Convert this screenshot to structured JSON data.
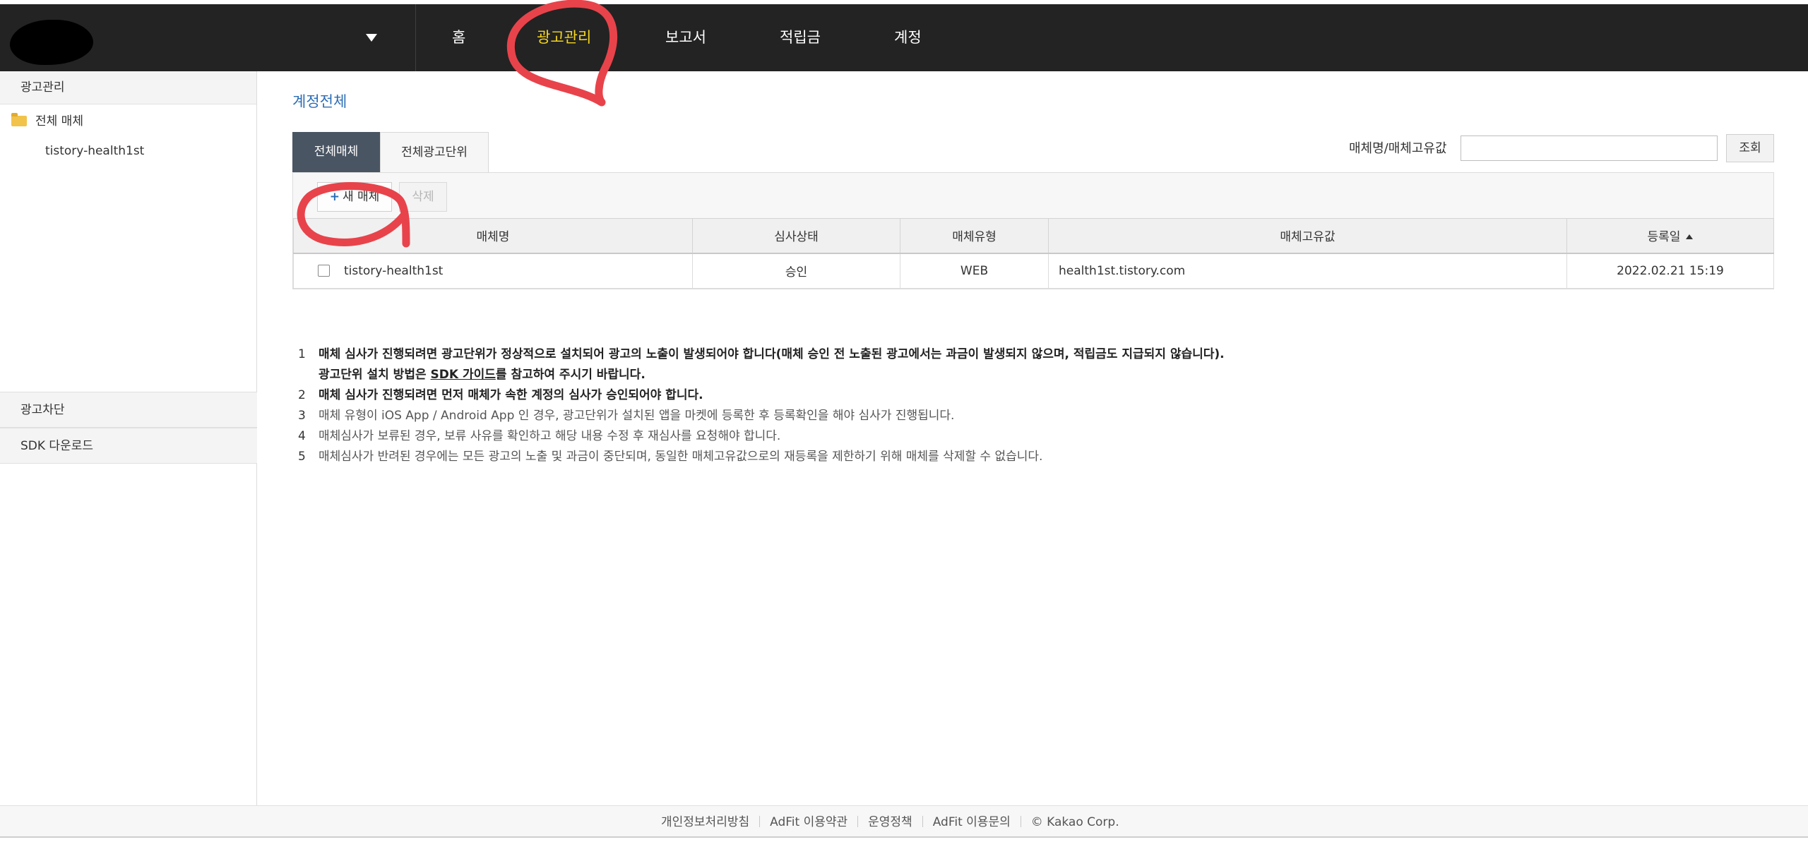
{
  "header": {
    "nav": [
      {
        "label": "홈",
        "active": false
      },
      {
        "label": "광고관리",
        "active": true
      },
      {
        "label": "보고서",
        "active": false
      },
      {
        "label": "적립금",
        "active": false
      },
      {
        "label": "계정",
        "active": false
      }
    ],
    "accent_color": "#f5d61f"
  },
  "sidebar": {
    "header": "광고관리",
    "tree_root": "전체 매체",
    "tree_child": "tistory-health1st",
    "sections": [
      "광고차단",
      "SDK 다운로드"
    ]
  },
  "main": {
    "title": "계정전체",
    "tabs": [
      {
        "label": "전체매체",
        "active": true
      },
      {
        "label": "전체광고단위",
        "active": false
      }
    ],
    "search": {
      "label": "매체명/매체고유값",
      "value": "",
      "button": "조회"
    },
    "toolbar": {
      "new_label": "새 매체",
      "delete_label": "삭제"
    },
    "table": {
      "columns": [
        "매체명",
        "심사상태",
        "매체유형",
        "매체고유값",
        "등록일"
      ],
      "rows": [
        {
          "name": "tistory-health1st",
          "status": "승인",
          "type": "WEB",
          "key": "health1st.tistory.com",
          "date": "2022.02.21 15:19"
        }
      ]
    },
    "notes": [
      {
        "num": "1",
        "text": "매체 심사가 진행되려면 광고단위가 정상적으로 설치되어 광고의 노출이 발생되어야 합니다(매체 승인 전 노출된 광고에서는 과금이 발생되지 않으며, 적립금도 지급되지 않습니다)."
      },
      {
        "pre": "광고단위 설치 방법은 ",
        "link": "SDK 가이드",
        "post": "를 참고하여 주시기 바랍니다."
      },
      {
        "num": "2",
        "text": "매체 심사가 진행되려면 먼저 매체가 속한 계정의 심사가 승인되어야 합니다."
      },
      {
        "num": "3",
        "text": "매체 유형이 iOS App / Android App 인 경우, 광고단위가 설치된 앱을 마켓에 등록한 후 등록확인을 해야 심사가 진행됩니다."
      },
      {
        "num": "4",
        "text": "매체심사가 보류된 경우, 보류 사유를 확인하고 해당 내용 수정 후 재심사를 요청해야 합니다."
      },
      {
        "num": "5",
        "text": "매체심사가 반려된 경우에는 모든 광고의 노출 및 과금이 중단되며, 동일한 매체고유값으로의 재등록을 제한하기 위해 매체를 삭제할 수 없습니다."
      }
    ]
  },
  "footer": {
    "links": [
      "개인정보처리방침",
      "AdFit 이용약관",
      "운영정책",
      "AdFit 이용문의"
    ],
    "copyright": "© Kakao Corp."
  },
  "annotation_color": "#e8434b"
}
